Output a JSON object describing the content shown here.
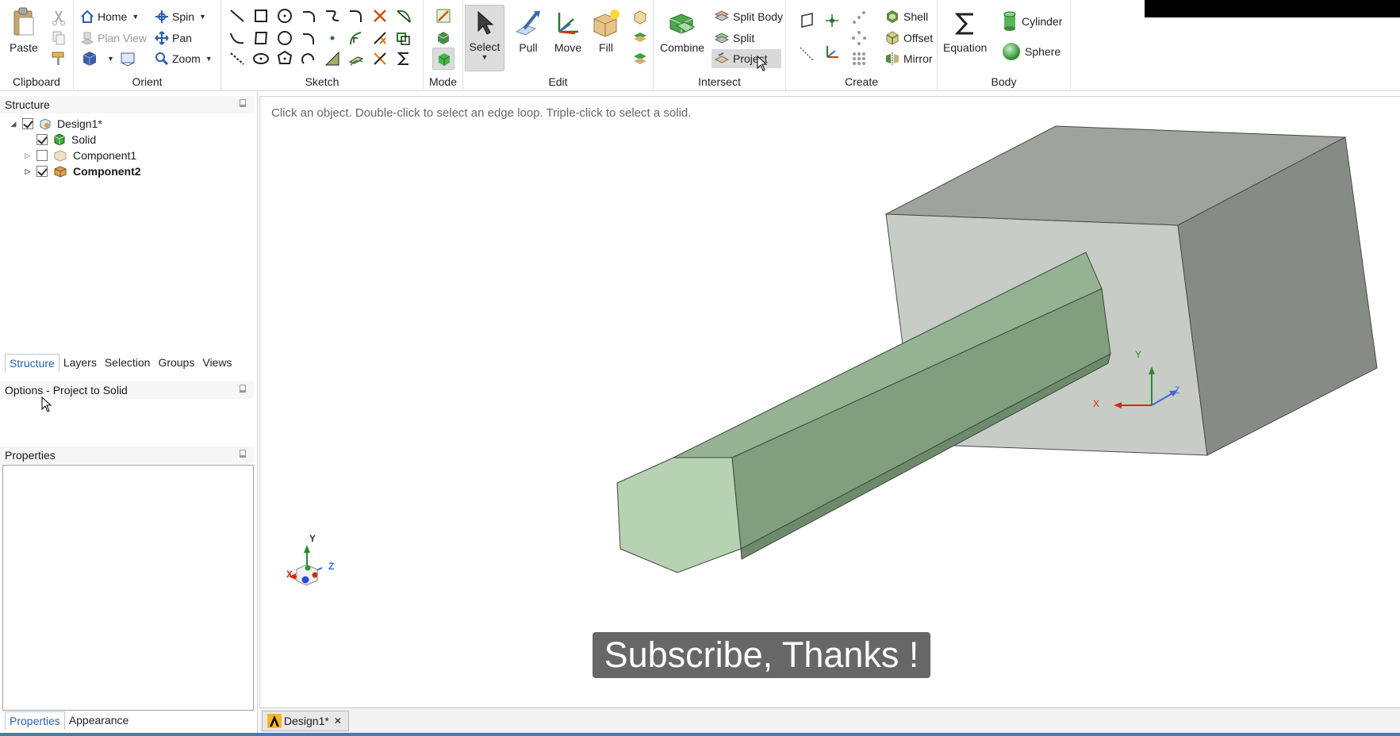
{
  "ribbon": {
    "clipboard": {
      "label": "Clipboard",
      "paste": "Paste"
    },
    "orient": {
      "label": "Orient",
      "home": "Home",
      "spin": "Spin",
      "plan_view": "Plan View",
      "pan": "Pan",
      "zoom": "Zoom"
    },
    "sketch": {
      "label": "Sketch"
    },
    "mode": {
      "label": "Mode"
    },
    "edit": {
      "label": "Edit",
      "select": "Select",
      "pull": "Pull",
      "move": "Move",
      "fill": "Fill"
    },
    "intersect": {
      "label": "Intersect",
      "combine": "Combine",
      "split_body": "Split Body",
      "split": "Split",
      "project": "Project"
    },
    "create": {
      "label": "Create",
      "shell": "Shell",
      "offset": "Offset",
      "mirror": "Mirror"
    },
    "body": {
      "label": "Body",
      "equation": "Equation",
      "cylinder": "Cylinder",
      "sphere": "Sphere"
    }
  },
  "structure": {
    "title": "Structure",
    "items": [
      {
        "label": "Design1*",
        "checked": true
      },
      {
        "label": "Solid",
        "checked": true
      },
      {
        "label": "Component1",
        "checked": false
      },
      {
        "label": "Component2",
        "checked": true
      }
    ]
  },
  "panel_tabs": [
    "Structure",
    "Layers",
    "Selection",
    "Groups",
    "Views"
  ],
  "options": {
    "title": "Options - Project to Solid"
  },
  "properties": {
    "title": "Properties",
    "tabs": [
      "Properties",
      "Appearance"
    ]
  },
  "viewport": {
    "hint": "Click an object. Double-click to select an edge loop. Triple-click to select a solid.",
    "subtitle": "Subscribe, Thanks !",
    "axis_labels": {
      "x": "X",
      "y": "Y",
      "z": "Z"
    }
  },
  "document_tab": {
    "label": "Design1*",
    "close": "✕"
  },
  "colors": {
    "accent": "#2b62b0",
    "solid_green": "#8fae8c",
    "box_gray": "#c7cbc5",
    "banner_green": "#23d119"
  }
}
